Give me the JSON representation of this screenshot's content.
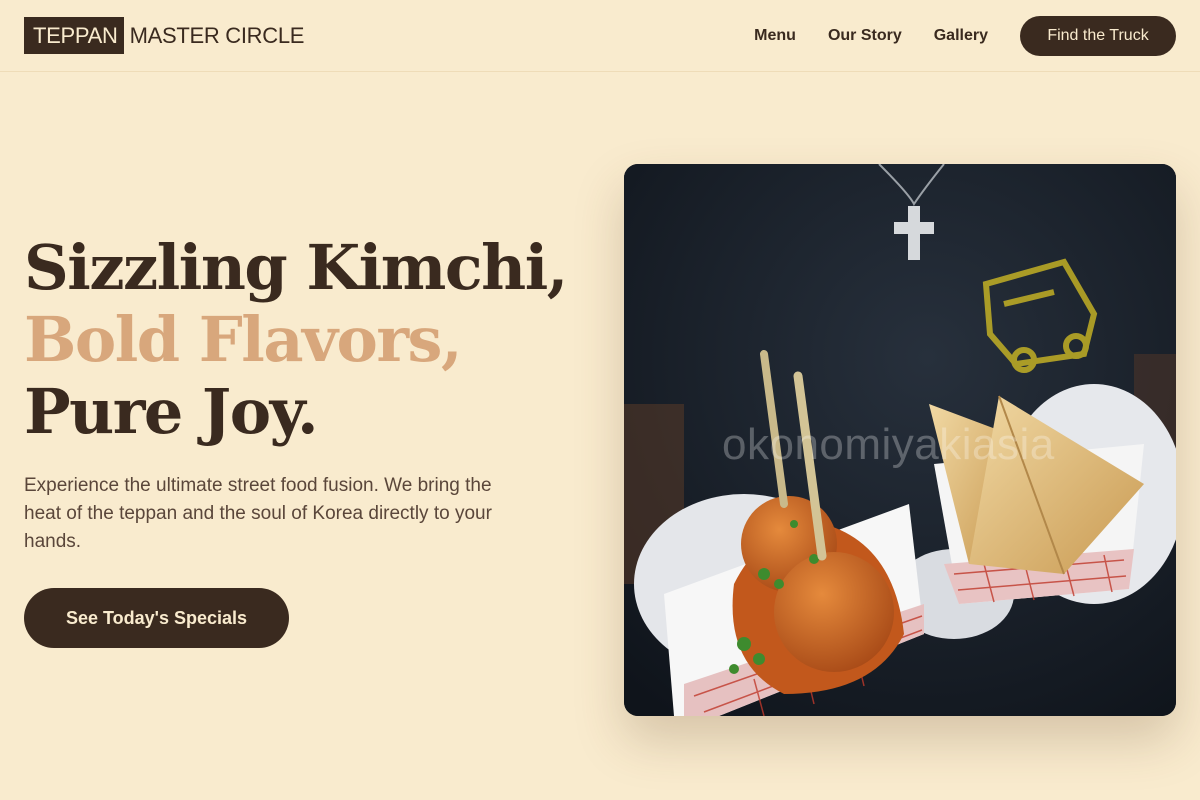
{
  "header": {
    "logo_box": "TEPPAN",
    "logo_rest": "MASTER CIRCLE",
    "nav": [
      "Menu",
      "Our Story",
      "Gallery"
    ],
    "cta": "Find the Truck"
  },
  "hero": {
    "headline_line1": "Sizzling Kimchi,",
    "headline_line2": "Bold Flavors,",
    "headline_line3": "Pure Joy.",
    "lead": "Experience the ultimate street food fusion. We bring the heat of the teppan and the soul of Korea directly to your hands.",
    "cta": "See Today's Specials",
    "image_watermark": "okonomiyakiasia"
  },
  "colors": {
    "background": "#f9ebce",
    "primary_dark": "#3a2a1f",
    "accent": "#d8a77c"
  }
}
